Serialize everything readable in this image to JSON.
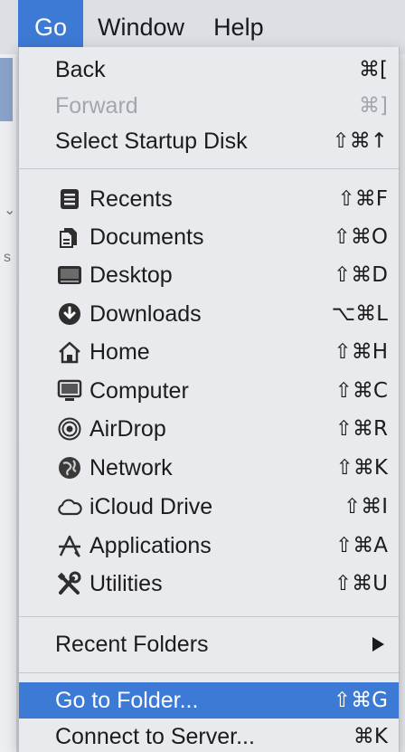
{
  "menubar": {
    "items": [
      {
        "label": "Go"
      },
      {
        "label": "Window"
      },
      {
        "label": "Help"
      }
    ]
  },
  "background": {
    "marks": [
      "⌄",
      "s"
    ]
  },
  "go_menu": {
    "top_items": [
      {
        "label": "Back",
        "shortcut": "⌘[",
        "enabled": true
      },
      {
        "label": "Forward",
        "shortcut": "⌘]",
        "enabled": false
      },
      {
        "label": "Select Startup Disk",
        "shortcut": "⇧⌘↑",
        "enabled": true
      }
    ],
    "places": [
      {
        "label": "Recents",
        "shortcut": "⇧⌘F",
        "icon": "recents-icon"
      },
      {
        "label": "Documents",
        "shortcut": "⇧⌘O",
        "icon": "documents-icon"
      },
      {
        "label": "Desktop",
        "shortcut": "⇧⌘D",
        "icon": "desktop-icon"
      },
      {
        "label": "Downloads",
        "shortcut": "⌥⌘L",
        "icon": "downloads-icon"
      },
      {
        "label": "Home",
        "shortcut": "⇧⌘H",
        "icon": "home-icon"
      },
      {
        "label": "Computer",
        "shortcut": "⇧⌘C",
        "icon": "computer-icon"
      },
      {
        "label": "AirDrop",
        "shortcut": "⇧⌘R",
        "icon": "airdrop-icon"
      },
      {
        "label": "Network",
        "shortcut": "⇧⌘K",
        "icon": "network-icon"
      },
      {
        "label": "iCloud Drive",
        "shortcut": "⇧⌘I",
        "icon": "icloud-icon"
      },
      {
        "label": "Applications",
        "shortcut": "⇧⌘A",
        "icon": "applications-icon"
      },
      {
        "label": "Utilities",
        "shortcut": "⇧⌘U",
        "icon": "utilities-icon"
      }
    ],
    "recent_folders": {
      "label": "Recent Folders"
    },
    "bottom_items": [
      {
        "label": "Go to Folder...",
        "shortcut": "⇧⌘G",
        "highlighted": true
      },
      {
        "label": "Connect to Server...",
        "shortcut": "⌘K",
        "highlighted": false
      }
    ]
  },
  "colors": {
    "highlight": "#3d7ad6",
    "menu_background": "#e8eaed",
    "disabled_text": "#a3a6ab"
  }
}
